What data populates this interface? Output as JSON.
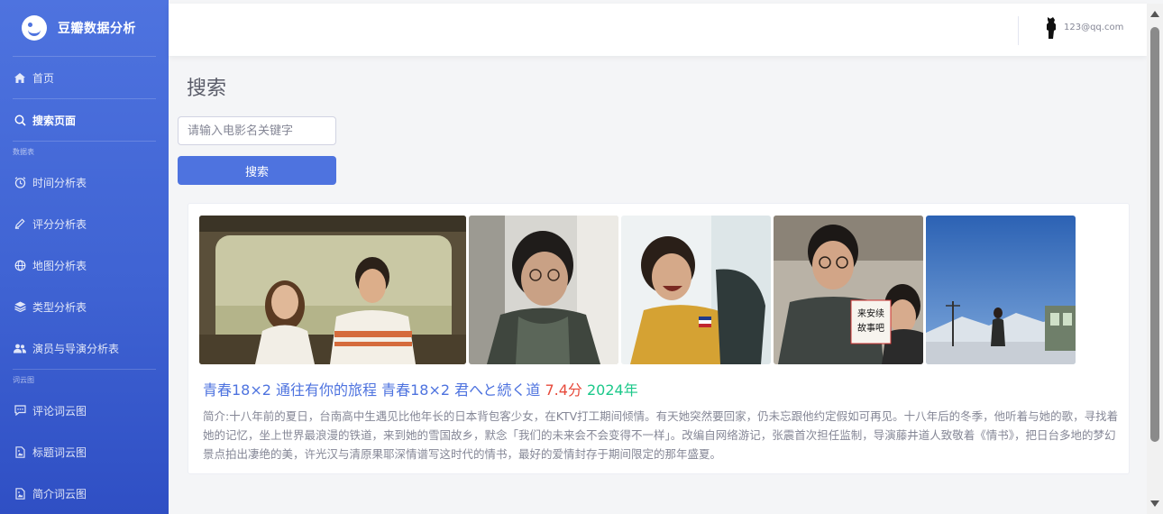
{
  "brand": {
    "name": "豆瓣数据分析"
  },
  "sidebar": {
    "items": [
      {
        "label": "首页",
        "icon": "home-icon"
      },
      {
        "label": "搜索页面",
        "icon": "search-icon",
        "active": true
      }
    ],
    "section_data": "数据表",
    "data_items": [
      {
        "label": "时间分析表",
        "icon": "clock-icon"
      },
      {
        "label": "评分分析表",
        "icon": "pen-icon"
      },
      {
        "label": "地图分析表",
        "icon": "globe-icon"
      },
      {
        "label": "类型分析表",
        "icon": "layers-icon"
      },
      {
        "label": "演员与导演分析表",
        "icon": "users-icon"
      }
    ],
    "section_cloud": "词云图",
    "cloud_items": [
      {
        "label": "评论词云图",
        "icon": "comment-icon"
      },
      {
        "label": "标题词云图",
        "icon": "file-image-icon"
      },
      {
        "label": "简介词云图",
        "icon": "file-image-icon"
      }
    ]
  },
  "topbar": {
    "user_email": "123@qq.com"
  },
  "main": {
    "title": "搜索",
    "search": {
      "placeholder": "请输入电影名关键字",
      "value": "",
      "button_label": "搜索"
    },
    "result": {
      "title": "青春18×2 通往有你的旅程 青春18×2 君へと続く道",
      "rating": "7.4分",
      "year": "2024年",
      "description": "简介:十八年前的夏日，台南高中生遇见比他年长的日本背包客少女，在KTV打工期间倾情。有天她突然要回家，仍未忘跟他约定假如可再见。十八年后的冬季，他听着与她的歌，寻找着她的记忆，坐上世界最浪漫的铁道，来到她的雪国故乡，默念「我们的未来会不会变得不一样」。改编自网络游记，张震首次担任监制，导演藤井道人致敬着《情书》，把日台多地的梦幻景点拍出凄绝的美，许光汉与清原果耶深情谱写这时代的情书，最好的爱情封存于期间限定的那年盛夏。",
      "poster_sign_text": "来安续\n故事吧"
    }
  },
  "colors": {
    "primary": "#4e73df",
    "rating": "#e74a3b",
    "year": "#1cc88a",
    "muted": "#858796"
  }
}
